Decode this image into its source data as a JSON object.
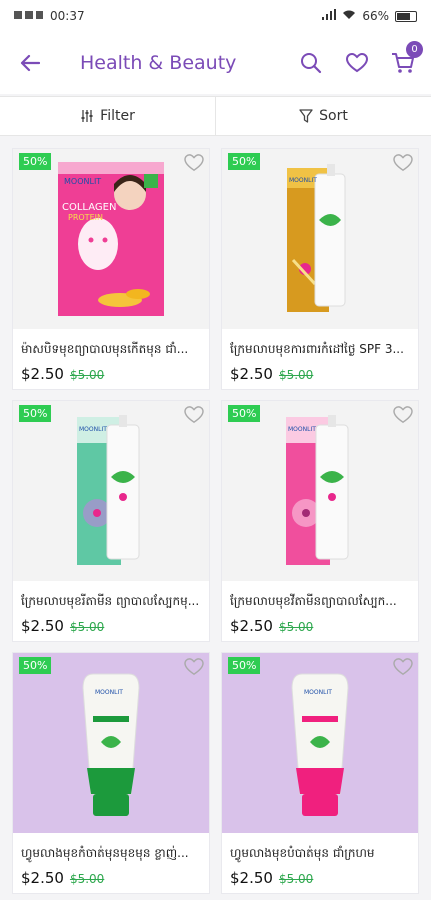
{
  "status": {
    "time": "00:37",
    "battery": "66%"
  },
  "header": {
    "title": "Health & Beauty",
    "cart_count": "0"
  },
  "toolbar": {
    "filter_label": "Filter",
    "sort_label": "Sort"
  },
  "products": [
    {
      "name": "ម៉ាសបិទមុខព្យាបាលមុនកើតមុន ជាំ...",
      "price": "$2.50",
      "old_price": "$5.00",
      "discount": "50%",
      "bg": "plain",
      "brand": "MOONLIT",
      "label": "COLLAGEN",
      "label2": "PROTEIN",
      "accent": "#e8278c"
    },
    {
      "name": "ក្រែមលាបមុខការពារកំដៅថ្ងៃ SPF 3...",
      "price": "$2.50",
      "old_price": "$5.00",
      "discount": "50%",
      "bg": "plain",
      "brand": "MOONLIT",
      "accent": "#d79a1f"
    },
    {
      "name": "ក្រែមលាបមុខរីតាមីន ព្យាបាលស្បែកមុ...",
      "price": "$2.50",
      "old_price": "$5.00",
      "discount": "50%",
      "bg": "plain",
      "brand": "MOONLIT",
      "accent": "#5fc8a4"
    },
    {
      "name": "ក្រែមលាបមុខវីតាមីនព្យាបាលស្បែក...",
      "price": "$2.50",
      "old_price": "$5.00",
      "discount": "50%",
      "bg": "plain",
      "brand": "MOONLIT",
      "accent": "#e8278c"
    },
    {
      "name": "ហ្វូមលាងមុខកំចាត់មុនមុខមុន ខ្លាញ់...",
      "price": "$2.50",
      "old_price": "$5.00",
      "discount": "50%",
      "bg": "lavender",
      "brand": "MOONLIT",
      "accent": "#1c9a3c"
    },
    {
      "name": "ហ្វូមលាងមុខបំបាត់មុន ជាំក្រហម",
      "price": "$2.50",
      "old_price": "$5.00",
      "discount": "50%",
      "bg": "lavender",
      "brand": "MOONLIT",
      "accent": "#f0207e"
    }
  ]
}
